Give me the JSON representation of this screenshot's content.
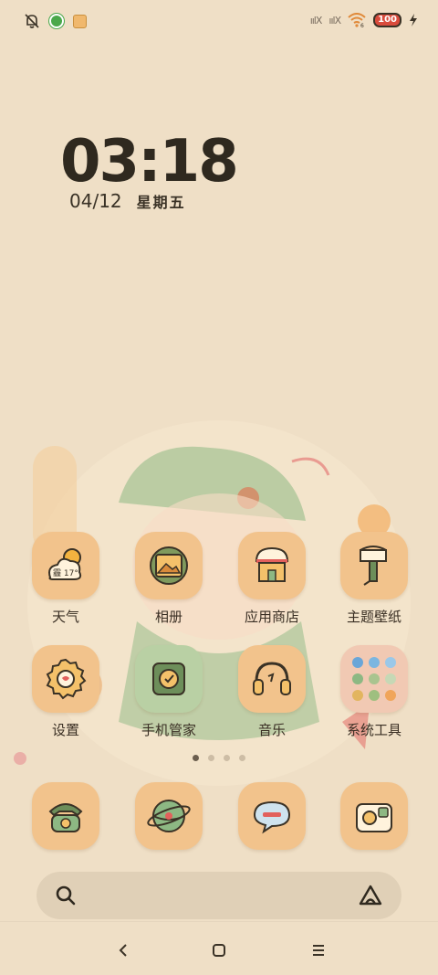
{
  "status_bar": {
    "battery": "100",
    "signal_labels": [
      "ıılX",
      "ıılX"
    ],
    "wifi_badge": "6"
  },
  "clock": {
    "time": "03:18",
    "date": "04/12",
    "weekday": "星期五"
  },
  "apps": [
    {
      "label": "天气",
      "icon": "weather-icon",
      "detail": "霾 17°"
    },
    {
      "label": "相册",
      "icon": "gallery-icon"
    },
    {
      "label": "应用商店",
      "icon": "app-store-icon"
    },
    {
      "label": "主题壁纸",
      "icon": "themes-icon"
    },
    {
      "label": "设置",
      "icon": "settings-icon"
    },
    {
      "label": "手机管家",
      "icon": "security-icon"
    },
    {
      "label": "音乐",
      "icon": "music-icon"
    },
    {
      "label": "系统工具",
      "icon": "system-tools-folder-icon"
    }
  ],
  "dock": [
    {
      "icon": "phone-icon"
    },
    {
      "icon": "browser-icon"
    },
    {
      "icon": "messages-icon"
    },
    {
      "icon": "camera-icon"
    }
  ],
  "page_indicator": {
    "pages": 4,
    "active": 0
  },
  "colors": {
    "background": "#efdfc6",
    "tile": "#f2c38c",
    "search_bar": "#e0d0b7",
    "text": "#3a3226"
  }
}
